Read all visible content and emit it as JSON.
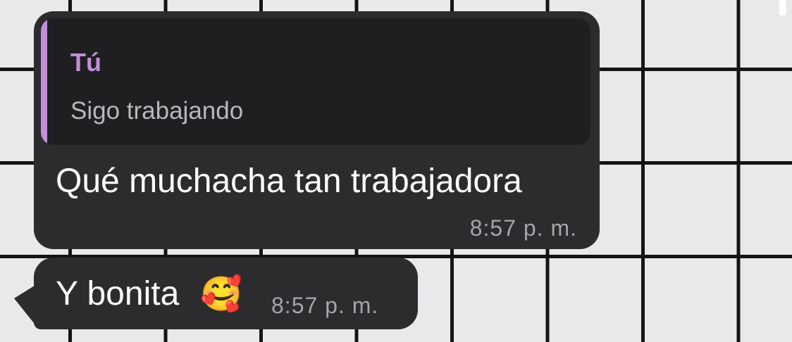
{
  "conversation": {
    "messages": [
      {
        "reply_to": {
          "author": "Tú",
          "text": "Sigo trabajando"
        },
        "text": "Qué muchacha tan trabajadora",
        "time": "8:57 p. m."
      },
      {
        "text": "Y bonita",
        "emoji": "🥰",
        "time": "8:57 p. m."
      }
    ]
  },
  "colors": {
    "bubble": "#2c2c2e",
    "quote_accent": "#c38fd8",
    "timestamp": "#a5a5aa",
    "grid_line": "#141414",
    "grid_cell": "#e9e9ec"
  }
}
